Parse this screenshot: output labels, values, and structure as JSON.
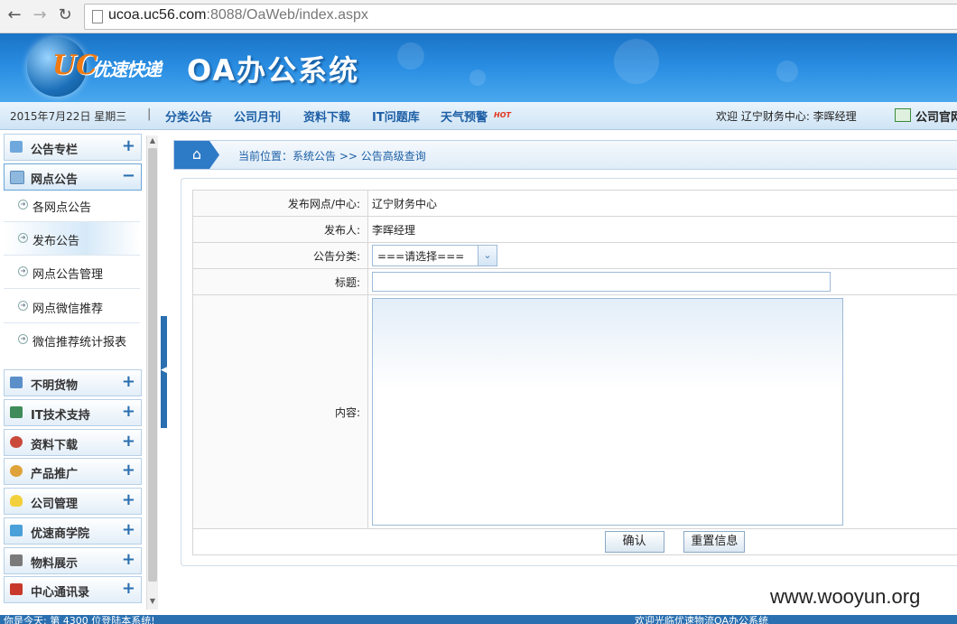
{
  "browser": {
    "url_host": "ucoa.uc56.com",
    "url_rest": ":8088/OaWeb/index.aspx"
  },
  "banner": {
    "logo_uc": "UC",
    "logo_cn": "优速快递",
    "system_title": "OA办公系统"
  },
  "topbar": {
    "date": "2015年7月22日 星期三",
    "separator": "|",
    "nav": [
      "分类公告",
      "公司月刊",
      "资料下载",
      "IT问题库",
      "天气预警"
    ],
    "hot_badge": "HOT",
    "welcome": "欢迎 辽宁财务中心: 李晖经理",
    "site_link": "公司官网"
  },
  "sidebar": {
    "top": {
      "label": "公告专栏",
      "toggle": "+",
      "icon_color": "#6fa8dc"
    },
    "open": {
      "label": "网点公告",
      "toggle": "−",
      "icon_color": "#8fb8de"
    },
    "subs": [
      "各网点公告",
      "发布公告",
      "网点公告管理",
      "网点微信推荐",
      "微信推荐统计报表"
    ],
    "groups": [
      {
        "label": "不明货物",
        "icon_color": "#5b8fc9"
      },
      {
        "label": "IT技术支持",
        "icon_color": "#3f8c5a"
      },
      {
        "label": "资料下载",
        "icon_color": "#c94a3b"
      },
      {
        "label": "产品推广",
        "icon_color": "#e0a23a"
      },
      {
        "label": "公司管理",
        "icon_color": "#f2d03b"
      },
      {
        "label": "优速商学院",
        "icon_color": "#4aa0d8"
      },
      {
        "label": "物料展示",
        "icon_color": "#7a7a7a"
      },
      {
        "label": "中心通讯录",
        "icon_color": "#c8392b"
      }
    ],
    "plus": "+"
  },
  "breadcrumb": "当前位置：系统公告 >> 公告高级查询",
  "form": {
    "site_label": "发布网点/中心:",
    "site_value": "辽宁财务中心",
    "publisher_label": "发布人:",
    "publisher_value": "李晖经理",
    "category_label": "公告分类:",
    "category_value": "===请选择===",
    "title_label": "标题:",
    "title_value": "",
    "content_label": "内容:",
    "content_value": "",
    "confirm": "确认",
    "reset": "重置信息"
  },
  "status": {
    "left": "你是今天: 第 4300 位登陆本系统!",
    "right": "欢迎光临优速物流OA办公系统"
  },
  "watermark": "www.wooyun.org"
}
